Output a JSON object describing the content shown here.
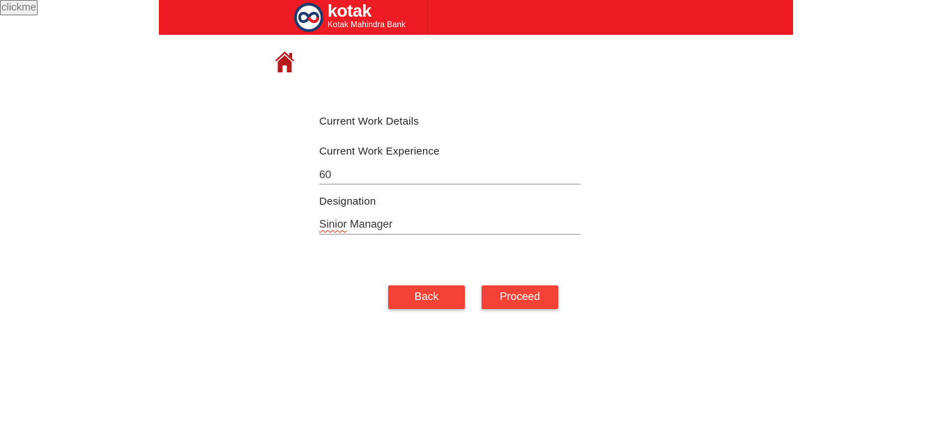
{
  "debug": {
    "clickme_label": "clickme"
  },
  "header": {
    "brand_name": "kotak",
    "brand_subtitle": "Kotak Mahindra Bank",
    "bar_color": "#ed1c24",
    "logo_icon": "kotak-infinity-logo"
  },
  "nav": {
    "home_icon": "home-icon",
    "home_color": "#b71c1c"
  },
  "form": {
    "section_title": "Current Work Details",
    "work_experience": {
      "label": "Current Work Experience",
      "value": "60"
    },
    "designation": {
      "label": "Designation",
      "value": "Sinior Manager",
      "misspelled_word": "Sinior",
      "rest_value": " Manager"
    }
  },
  "actions": {
    "back_label": "Back",
    "proceed_label": "Proceed",
    "button_color": "#f44336"
  }
}
